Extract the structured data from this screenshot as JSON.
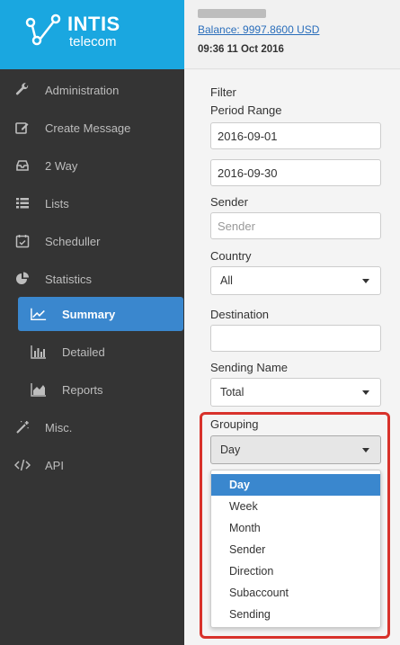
{
  "logo": {
    "brand": "INTIS",
    "sub": "telecom"
  },
  "header": {
    "balance": "Balance: 9997.8600 USD",
    "datetime": "09:36 11 Oct 2016"
  },
  "sidebar": {
    "items": [
      {
        "label": "Administration",
        "icon": "wrench-icon"
      },
      {
        "label": "Create Message",
        "icon": "edit-icon"
      },
      {
        "label": "2 Way",
        "icon": "inbox-icon"
      },
      {
        "label": "Lists",
        "icon": "list-icon"
      },
      {
        "label": "Scheduller",
        "icon": "calendar-check-icon"
      },
      {
        "label": "Statistics",
        "icon": "pie-chart-icon"
      },
      {
        "label": "Misc.",
        "icon": "magic-wand-icon"
      },
      {
        "label": "API",
        "icon": "code-icon"
      }
    ],
    "subitems": [
      {
        "label": "Summary",
        "icon": "line-chart-icon",
        "active": true
      },
      {
        "label": "Detailed",
        "icon": "bar-chart-icon"
      },
      {
        "label": "Reports",
        "icon": "area-chart-icon"
      }
    ]
  },
  "filter": {
    "title": "Filter",
    "period_label": "Period Range",
    "date_from": "2016-09-01",
    "date_to": "2016-09-30",
    "sender_label": "Sender",
    "sender_placeholder": "Sender",
    "country_label": "Country",
    "country_value": "All",
    "destination_label": "Destination",
    "destination_value": "",
    "sending_name_label": "Sending Name",
    "sending_name_value": "Total",
    "grouping_label": "Grouping",
    "grouping_value": "Day",
    "grouping_options": [
      "Day",
      "Week",
      "Month",
      "Sender",
      "Direction",
      "Subaccount",
      "Sending"
    ]
  },
  "colors": {
    "sidebar_bg": "#343434",
    "logo_bg": "#1aa7e0",
    "accent": "#3a87ce",
    "highlight": "#d8322b"
  }
}
